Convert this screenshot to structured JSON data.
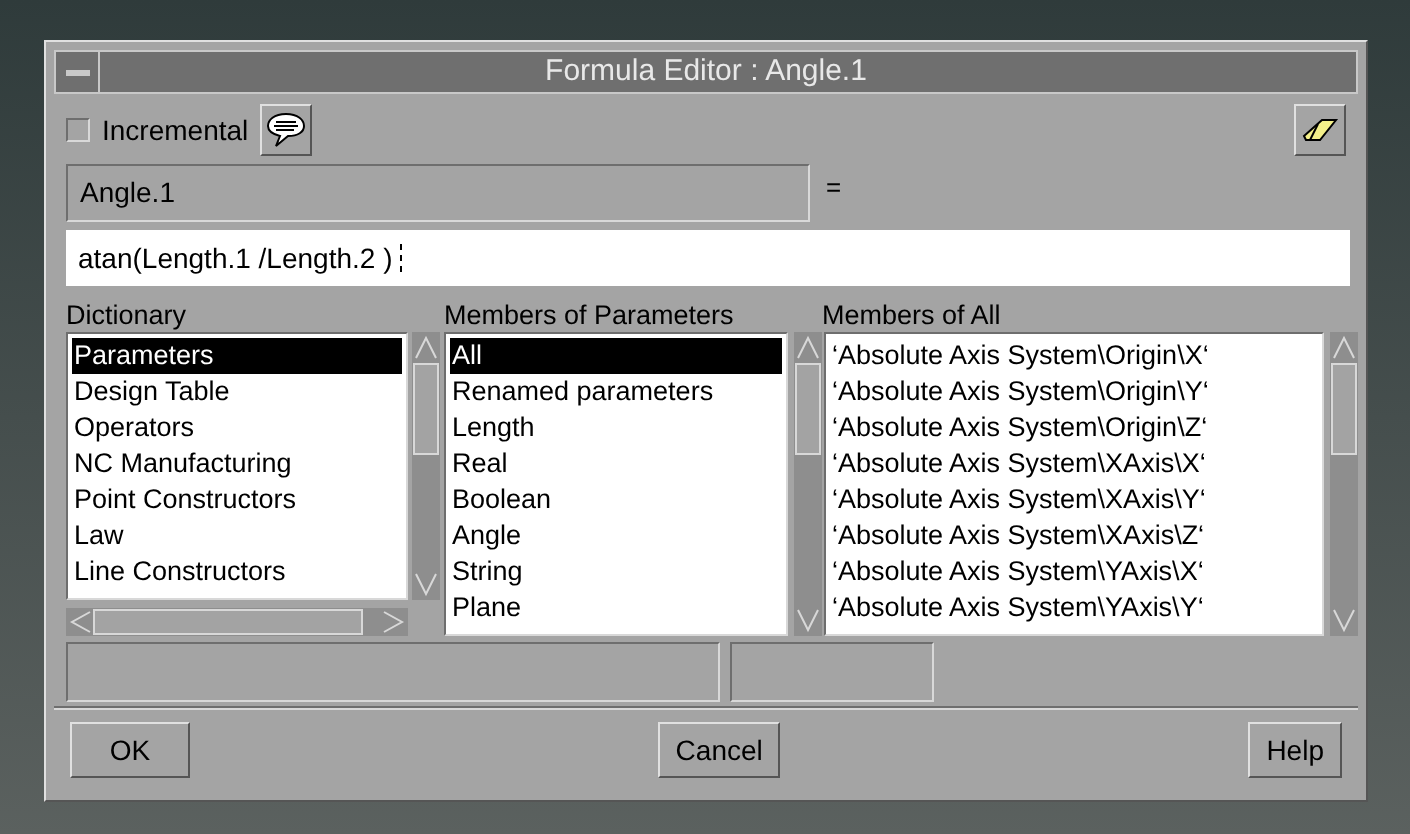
{
  "window": {
    "title": "Formula Editor : Angle.1"
  },
  "incremental": {
    "label": "Incremental",
    "checked": false
  },
  "parameter_field": {
    "value": "Angle.1"
  },
  "equals": "=",
  "formula_field": {
    "value": "atan(Length.1 /Length.2 )"
  },
  "lists": [
    {
      "title": "Dictionary",
      "items": [
        {
          "label": "Parameters",
          "selected": true
        },
        {
          "label": "Design Table",
          "selected": false
        },
        {
          "label": "Operators",
          "selected": false
        },
        {
          "label": "NC Manufacturing",
          "selected": false
        },
        {
          "label": "Point Constructors",
          "selected": false
        },
        {
          "label": "Law",
          "selected": false
        },
        {
          "label": "Line Constructors",
          "selected": false
        }
      ]
    },
    {
      "title": "Members of Parameters",
      "items": [
        {
          "label": "All",
          "selected": true
        },
        {
          "label": "Renamed parameters",
          "selected": false
        },
        {
          "label": "Length",
          "selected": false
        },
        {
          "label": "Real",
          "selected": false
        },
        {
          "label": "Boolean",
          "selected": false
        },
        {
          "label": "Angle",
          "selected": false
        },
        {
          "label": "String",
          "selected": false
        },
        {
          "label": "Plane",
          "selected": false
        }
      ]
    },
    {
      "title": "Members of All",
      "items": [
        {
          "label": "‘Absolute Axis System\\Origin\\X‘",
          "selected": false
        },
        {
          "label": "‘Absolute Axis System\\Origin\\Y‘",
          "selected": false
        },
        {
          "label": "‘Absolute Axis System\\Origin\\Z‘",
          "selected": false
        },
        {
          "label": "‘Absolute Axis System\\XAxis\\X‘",
          "selected": false
        },
        {
          "label": "‘Absolute Axis System\\XAxis\\Y‘",
          "selected": false
        },
        {
          "label": "‘Absolute Axis System\\XAxis\\Z‘",
          "selected": false
        },
        {
          "label": "‘Absolute Axis System\\YAxis\\X‘",
          "selected": false
        },
        {
          "label": "‘Absolute Axis System\\YAxis\\Y‘",
          "selected": false
        }
      ]
    }
  ],
  "buttons": [
    "OK",
    "Cancel",
    "Help"
  ]
}
